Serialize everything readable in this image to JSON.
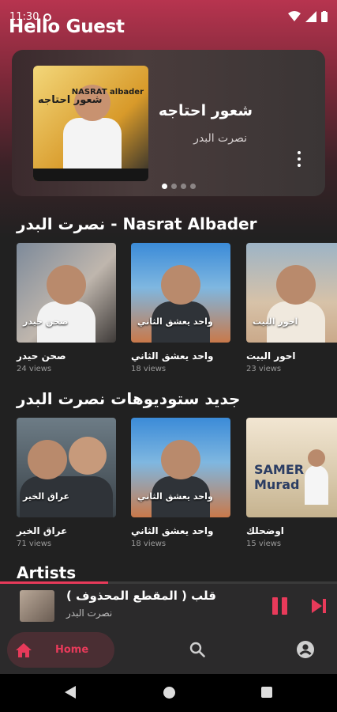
{
  "status_bar": {
    "time": "11:30"
  },
  "header": {
    "greeting": "Hello Guest"
  },
  "hero": {
    "art_title": "شعور احتاجه",
    "art_artist": "NASRAT albader",
    "title": "شعور احتاجه",
    "artist": "نصرت البدر",
    "pages": 4,
    "active_page": 0
  },
  "sections": [
    {
      "title": "نصرت البدر - Nasrat Albader",
      "items": [
        {
          "name": "صحن حيدر",
          "views": "24 views",
          "art_label": "صحن حيدر"
        },
        {
          "name": "واحد يعشق الثاني",
          "views": "18 views",
          "art_label": "واحد يعشق الثاني"
        },
        {
          "name": "احور البيت",
          "views": "23 views",
          "art_label": "احور البيت"
        }
      ]
    },
    {
      "title": "جديد ستوديوهات نصرت البدر",
      "items": [
        {
          "name": "عراق الخير",
          "views": "71 views",
          "art_label": "عراق الخير"
        },
        {
          "name": "واحد يعشق الثاني",
          "views": "18 views",
          "art_label": "واحد يعشق الثاني"
        },
        {
          "name": "اوضحلك",
          "views": "15 views",
          "art_label": "SAMER Murad"
        }
      ]
    }
  ],
  "artists_title": "Artists",
  "player": {
    "title": "قلب ( المقطع المحذوف )",
    "artist": "نصرت البدر",
    "progress": 0.32,
    "accent": "#e83a5a"
  },
  "bottom_nav": {
    "home_label": "Home",
    "items": [
      "home-icon",
      "search-icon",
      "profile-icon"
    ]
  }
}
